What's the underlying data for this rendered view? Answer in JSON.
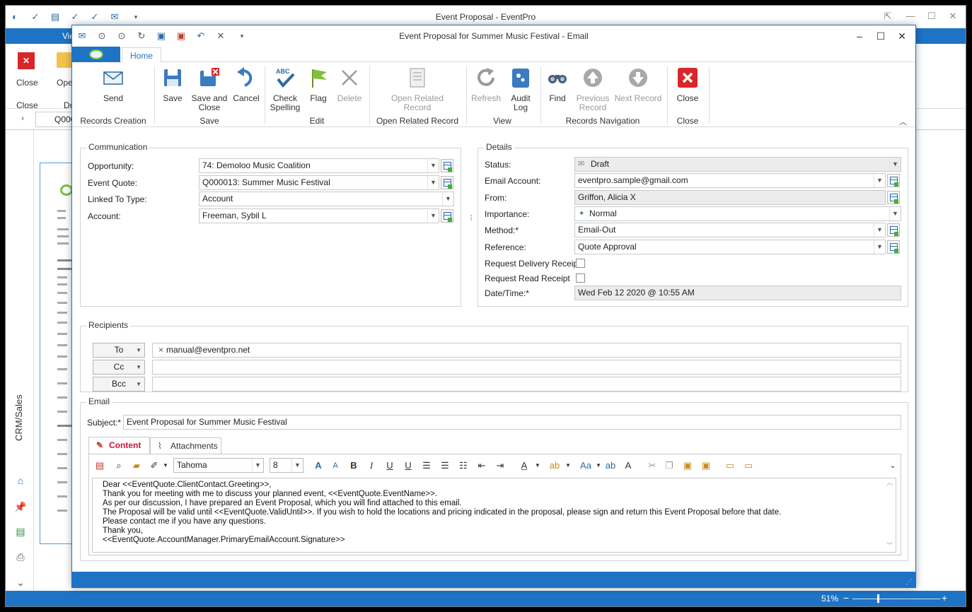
{
  "app": {
    "title": "Event Proposal - EventPro",
    "view_tab": "Vie",
    "ribbon_close": "Close",
    "ribbon_open": "Ope",
    "group_close": "Close",
    "group_do": "Do",
    "nav_record": "Q000",
    "side_label": "CRM/Sales",
    "zoom": "51%"
  },
  "window": {
    "title": "Event Proposal for Summer Music Festival - Email",
    "tab_home": "Home"
  },
  "ribbon": {
    "send": "Send",
    "save": "Save",
    "save_close_1": "Save and",
    "save_close_2": "Close",
    "cancel": "Cancel",
    "check_1": "Check",
    "check_2": "Spelling",
    "check_abc": "ABC",
    "flag": "Flag",
    "delete": "Delete",
    "open_related_1": "Open Related",
    "open_related_2": "Record",
    "refresh": "Refresh",
    "audit_1": "Audit",
    "audit_2": "Log",
    "find": "Find",
    "prev_1": "Previous",
    "prev_2": "Record",
    "next": "Next Record",
    "close": "Close",
    "groups": {
      "records_creation": "Records Creation",
      "save": "Save",
      "edit": "Edit",
      "open_related": "Open Related Record",
      "view": "View",
      "records_navigation": "Records Navigation",
      "close": "Close"
    }
  },
  "communication": {
    "title": "Communication",
    "opportunity_label": "Opportunity:",
    "opportunity_value": "74: Demoloo Music Coalition",
    "event_quote_label": "Event Quote:",
    "event_quote_value": "Q000013: Summer Music Festival",
    "linked_type_label": "Linked To Type:",
    "linked_type_value": "Account",
    "account_label": "Account:",
    "account_value": "Freeman, Sybil L"
  },
  "details": {
    "title": "Details",
    "status_label": "Status:",
    "status_value": "Draft",
    "email_account_label": "Email Account:",
    "email_account_value": "eventpro.sample@gmail.com",
    "from_label": "From:",
    "from_value": "Griffon, Alicia X",
    "importance_label": "Importance:",
    "importance_value": "Normal",
    "method_label": "Method:*",
    "method_value": "Email-Out",
    "reference_label": "Reference:",
    "reference_value": "Quote Approval",
    "delivery_receipt_label": "Request Delivery Receipt",
    "read_receipt_label": "Request Read Receipt",
    "datetime_label": "Date/Time:*",
    "datetime_value": "Wed Feb 12 2020 @ 10:55 AM"
  },
  "recipients": {
    "title": "Recipients",
    "to": "To",
    "cc": "Cc",
    "bcc": "Bcc",
    "to_value": "manual@eventpro.net"
  },
  "email": {
    "title": "Email",
    "subject_label": "Subject:*",
    "subject_value": "Event Proposal for Summer Music Festival",
    "tab_content": "Content",
    "tab_attachments": "Attachments",
    "font_name": "Tahoma",
    "font_size": "8",
    "body_lines": [
      "Dear <<EventQuote.ClientContact.Greeting>>,",
      "Thank you for meeting with me to discuss your planned event, <<EventQuote.EventName>>.",
      "As per our discussion, I have prepared an Event Proposal, which you will find attached to this email.",
      "The Proposal will be valid until <<EventQuote.ValidUntil>>.  If you wish to hold the locations and pricing indicated in the proposal, please sign and return this Event Proposal before that date.",
      "Please contact me if you have any questions.",
      "Thank you,",
      "<<EventQuote.AccountManager.PrimaryEmailAccount.Signature>>"
    ]
  },
  "colors": {
    "accent": "#1e73c5",
    "close_red": "#d9262b",
    "content_tab": "#d0103a"
  }
}
